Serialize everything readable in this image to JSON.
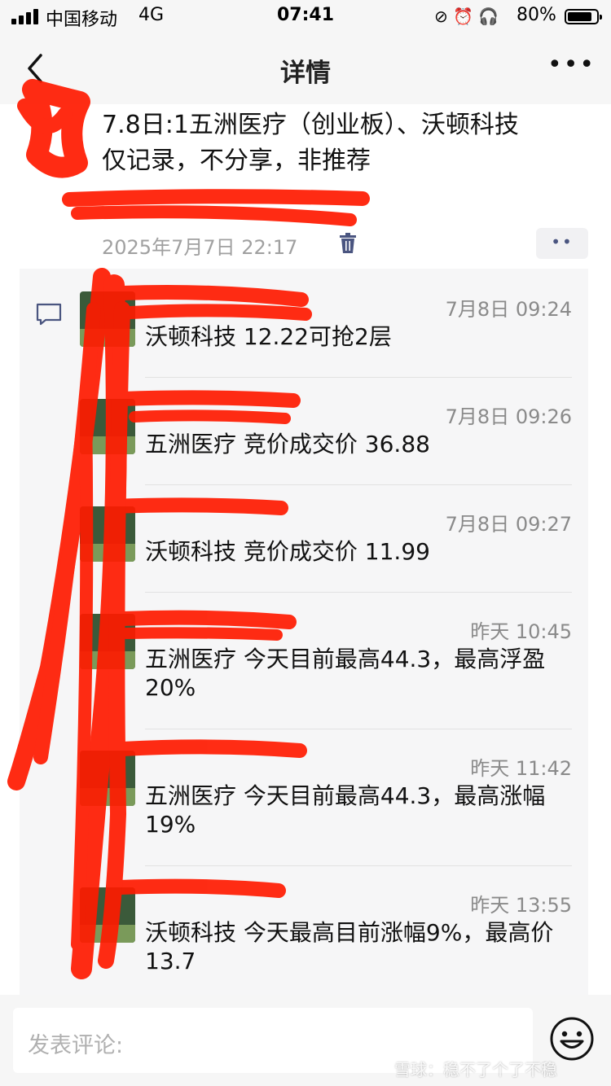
{
  "status_bar": {
    "carrier": "中国移动",
    "network": "4G",
    "time": "07:41",
    "battery": "80%"
  },
  "nav": {
    "title": "详情",
    "more": "•••"
  },
  "post": {
    "line1": "7.8日:1五洲医疗（创业板）、沃顿科技",
    "line2": "仅记录，不分享，非推荐",
    "date": "2025年7月7日 22:17",
    "more_dots": "••"
  },
  "comments": [
    {
      "time": "7月8日 09:24",
      "text": "沃顿科技 12.22可抢2层"
    },
    {
      "time": "7月8日 09:26",
      "text": "五洲医疗 竞价成交价 36.88"
    },
    {
      "time": "7月8日 09:27",
      "text": "沃顿科技 竞价成交价 11.99"
    },
    {
      "time": "昨天 10:45",
      "text": "五洲医疗 今天目前最高44.3，最高浮盈20%"
    },
    {
      "time": "昨天 11:42",
      "text": "五洲医疗 今天目前最高44.3，最高涨幅19%"
    },
    {
      "time": "昨天 13:55",
      "text": "沃顿科技 今天最高目前涨幅9%，最高价13.7"
    }
  ],
  "bottom": {
    "input_placeholder": "发表评论:",
    "watermark": "雪球：稳不了个了不稳"
  },
  "colors": {
    "link": "#4a5580",
    "redaction": "#ff1a00"
  }
}
